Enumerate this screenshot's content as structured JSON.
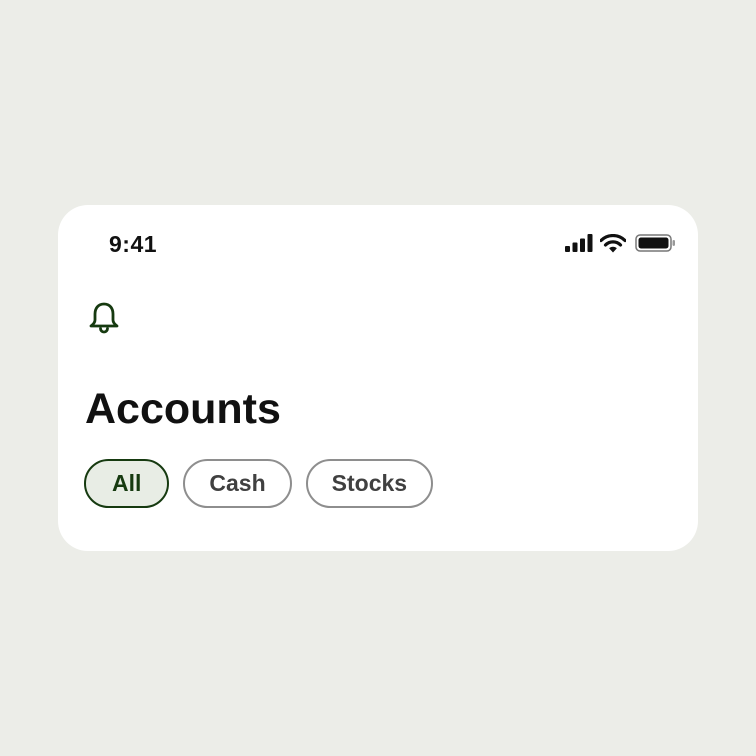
{
  "status_bar": {
    "time": "9:41",
    "icons": [
      "cellular-signal-icon",
      "wifi-icon",
      "battery-icon"
    ]
  },
  "header": {
    "notification_icon": "bell-icon"
  },
  "page": {
    "title": "Accounts"
  },
  "filters": {
    "chips": [
      {
        "label": "All",
        "selected": true
      },
      {
        "label": "Cash",
        "selected": false
      },
      {
        "label": "Stocks",
        "selected": false
      }
    ]
  },
  "colors": {
    "background": "#ecede8",
    "card": "#ffffff",
    "accent": "#163a10",
    "accent_fill": "#e8ede5",
    "chip_border": "#8e8e8e",
    "text": "#111111"
  }
}
